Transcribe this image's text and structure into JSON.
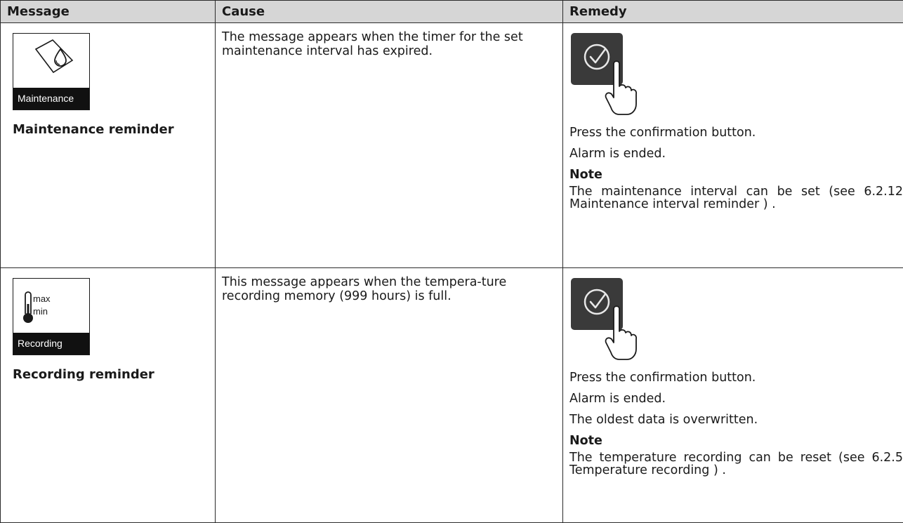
{
  "headers": {
    "message": "Message",
    "cause": "Cause",
    "remedy": "Remedy"
  },
  "rows": [
    {
      "icon_name": "maintenance-drop-icon",
      "icon_label": "Maintenance",
      "title": "Maintenance reminder",
      "cause": "The message appears when the timer for the set maintenance interval has expired.",
      "button_icon": "confirm-check-icon",
      "remedy_lines": [
        "Press the confirmation button.",
        "Alarm is ended."
      ],
      "note_label": "Note",
      "note_text": "The maintenance interval can be set (see 6.2.12 Maintenance interval reminder ) ."
    },
    {
      "icon_name": "thermometer-max-min-icon",
      "icon_max": "max",
      "icon_min": "min",
      "icon_label": "Recording",
      "title": "Recording reminder",
      "cause": "This message appears when the tempera-ture recording memory (999 hours) is full.",
      "button_icon": "confirm-check-icon",
      "remedy_lines": [
        "Press the confirmation button.",
        "Alarm is ended.",
        "The oldest data is overwritten."
      ],
      "note_label": "Note",
      "note_text": "The temperature recording can be reset (see 6.2.5 Temperature recording ) ."
    }
  ],
  "colors": {
    "header_bg": "#d6d6d6",
    "button_bg": "#3a3a3a",
    "border": "#2b2b2b"
  }
}
